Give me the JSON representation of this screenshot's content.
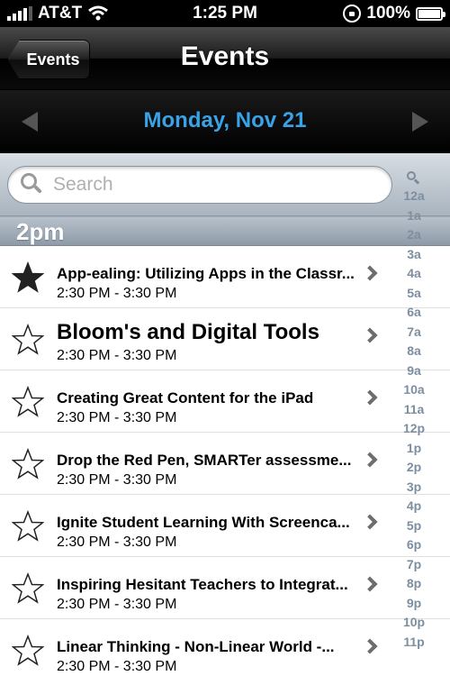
{
  "status_bar": {
    "carrier": "AT&T",
    "time": "1:25 PM",
    "battery": "100%"
  },
  "nav": {
    "back_label": "Events",
    "title": "Events"
  },
  "date_bar": {
    "date": "Monday, Nov 21"
  },
  "search": {
    "placeholder": "Search"
  },
  "section": {
    "title": "2pm"
  },
  "events": [
    {
      "title": "App-ealing: Utilizing Apps in the Classr...",
      "time": "2:30 PM - 3:30 PM",
      "starred": true
    },
    {
      "title": "Bloom's and Digital Tools",
      "time": "2:30 PM - 3:30 PM",
      "starred": false
    },
    {
      "title": "Creating Great Content for the iPad",
      "time": "2:30 PM - 3:30 PM",
      "starred": false
    },
    {
      "title": "Drop the Red Pen, SMARTer assessme...",
      "time": "2:30 PM - 3:30 PM",
      "starred": false
    },
    {
      "title": "Ignite Student Learning With Screenca...",
      "time": "2:30 PM - 3:30 PM",
      "starred": false
    },
    {
      "title": "Inspiring Hesitant Teachers to Integrat...",
      "time": "2:30 PM - 3:30 PM",
      "starred": false
    },
    {
      "title": "Linear Thinking - Non-Linear World -...",
      "time": "2:30 PM - 3:30 PM",
      "starred": false
    }
  ],
  "index": [
    "12a",
    "1a",
    "2a",
    "3a",
    "4a",
    "5a",
    "6a",
    "7a",
    "8a",
    "9a",
    "10a",
    "11a",
    "12p",
    "1p",
    "2p",
    "3p",
    "4p",
    "5p",
    "6p",
    "7p",
    "8p",
    "9p",
    "10p",
    "11p"
  ],
  "colors": {
    "date_accent": "#3aa2e6",
    "index_text": "#7d8ea0"
  },
  "icons": {
    "signal": "signal-bars-icon",
    "wifi": "wifi-icon",
    "rotation_lock": "rotation-lock-icon",
    "battery": "battery-icon",
    "search": "search-icon",
    "star_filled": "star-filled-icon",
    "star_outline": "star-outline-icon",
    "chevron": "chevron-right-icon"
  }
}
